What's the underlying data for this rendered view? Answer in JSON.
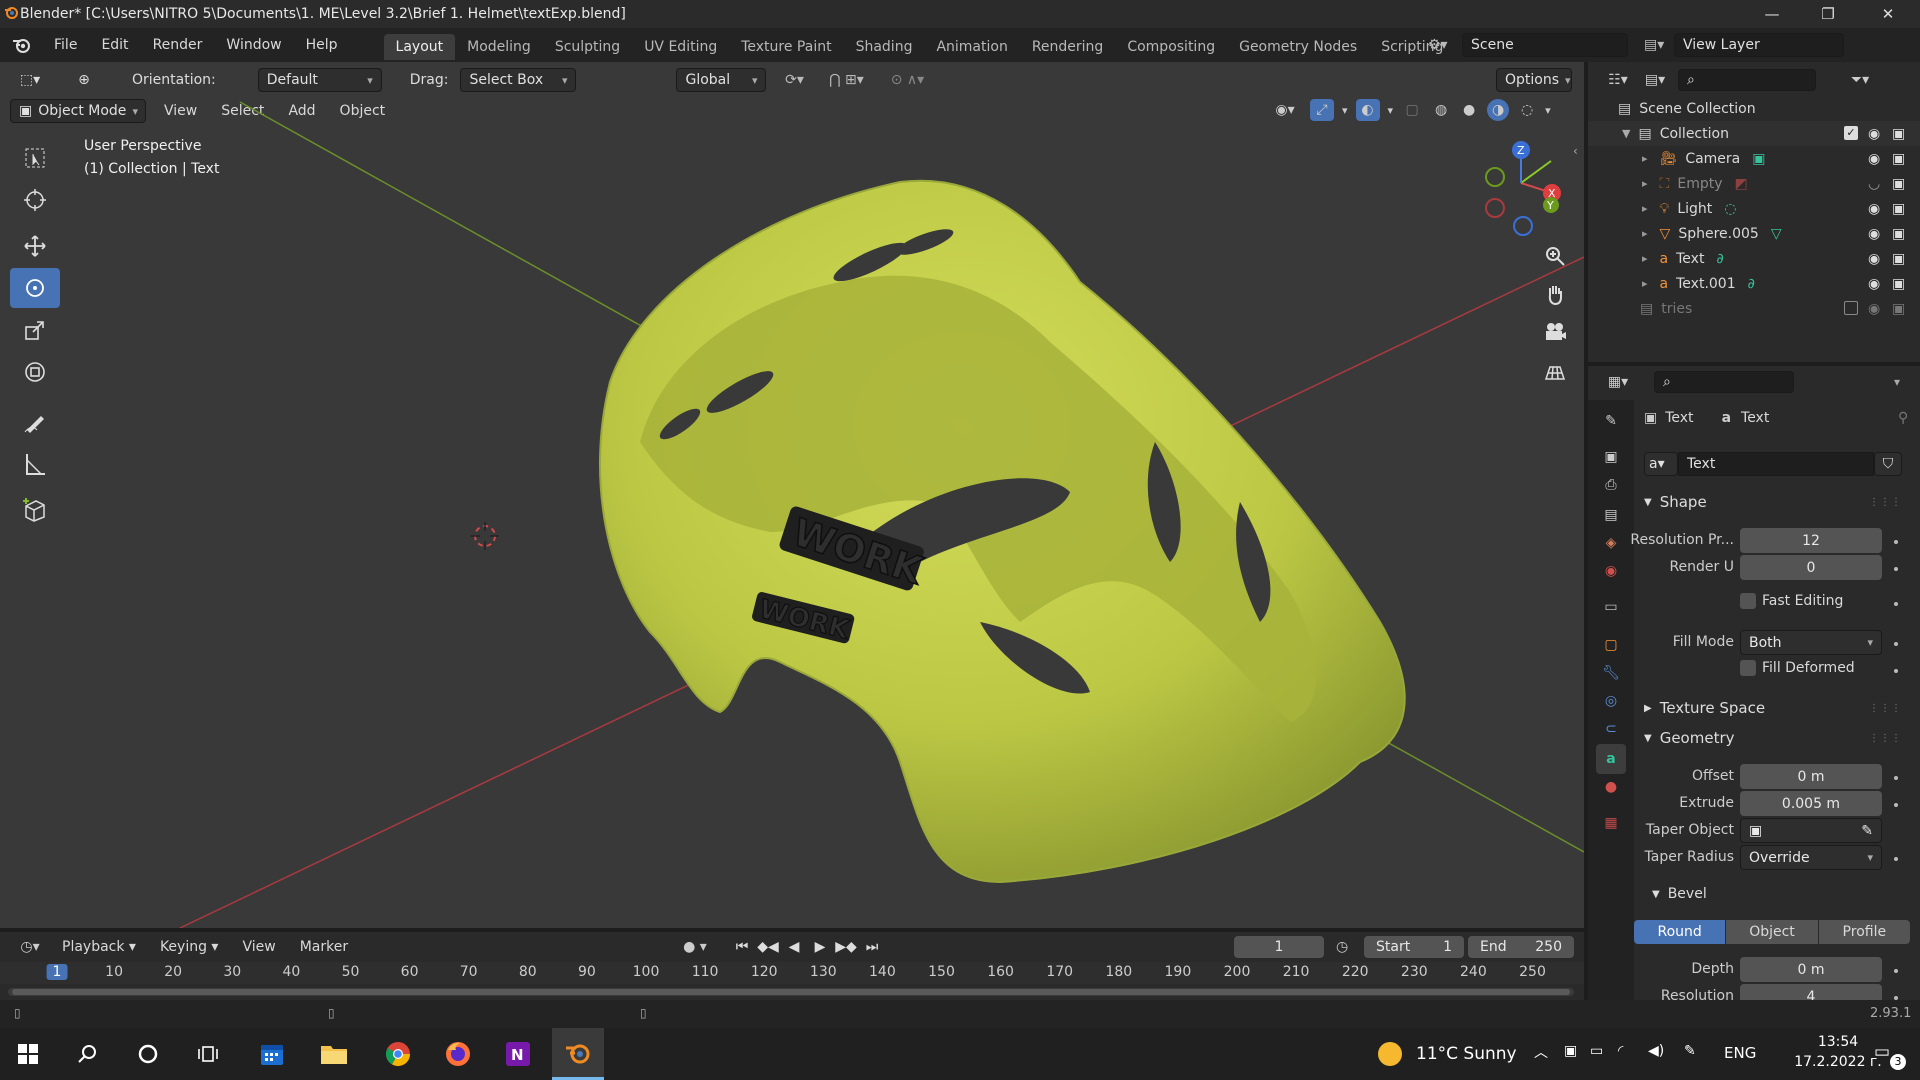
{
  "window": {
    "title": "Blender* [C:\\Users\\NITRO 5\\Documents\\1. ME\\Level 3.2\\Brief 1. Helmet\\textExp.blend]",
    "controls": [
      "—",
      "❐",
      "✕"
    ]
  },
  "menu": {
    "items": [
      "File",
      "Edit",
      "Render",
      "Window",
      "Help"
    ],
    "workspaces": [
      "Layout",
      "Modeling",
      "Sculpting",
      "UV Editing",
      "Texture Paint",
      "Shading",
      "Animation",
      "Rendering",
      "Compositing",
      "Geometry Nodes",
      "Scripting"
    ],
    "active_workspace": "Layout",
    "scene": "Scene",
    "view_layer": "View Layer"
  },
  "viewport": {
    "orientation_label": "Orientation:",
    "orientation_value": "Default",
    "drag_label": "Drag:",
    "drag_value": "Select Box",
    "transform_space": "Global",
    "options_label": "Options",
    "mode": "Object Mode",
    "header_menus": [
      "View",
      "Select",
      "Add",
      "Object"
    ],
    "overlay_title": "User Perspective",
    "overlay_subtitle": "(1) Collection | Text",
    "helmet_color": "#c5d148",
    "gizmo": {
      "x": "X",
      "y": "Y",
      "z": "Z"
    }
  },
  "outliner": {
    "root": "Scene Collection",
    "collection": "Collection",
    "items": [
      {
        "name": "Camera",
        "icon": "camera-icon",
        "dim": false
      },
      {
        "name": "Empty",
        "icon": "empty-icon",
        "dim": true
      },
      {
        "name": "Light",
        "icon": "light-icon",
        "dim": false
      },
      {
        "name": "Sphere.005",
        "icon": "mesh-icon",
        "dim": false
      },
      {
        "name": "Text",
        "icon": "text-icon",
        "dim": false
      },
      {
        "name": "Text.001",
        "icon": "text-icon",
        "dim": false
      }
    ],
    "excluded": "tries"
  },
  "properties": {
    "breadcrumb_object": "Text",
    "breadcrumb_data": "Text",
    "datablock": "Text",
    "shape_header": "Shape",
    "resolution_preview_label": "Resolution Pr...",
    "resolution_preview": "12",
    "render_u_label": "Render U",
    "render_u": "0",
    "fast_editing": "Fast Editing",
    "fill_mode_label": "Fill Mode",
    "fill_mode": "Both",
    "fill_deformed": "Fill Deformed",
    "texture_space_header": "Texture Space",
    "geometry_header": "Geometry",
    "offset_label": "Offset",
    "offset": "0 m",
    "extrude_label": "Extrude",
    "extrude": "0.005 m",
    "taper_object_label": "Taper Object",
    "taper_radius_label": "Taper Radius",
    "taper_radius": "Override",
    "bevel_header": "Bevel",
    "bevel_modes": [
      "Round",
      "Object",
      "Profile"
    ],
    "depth_label": "Depth",
    "depth": "0 m",
    "resolution_label": "Resolution",
    "resolution": "4"
  },
  "timeline": {
    "menus": [
      "Playback",
      "Keying",
      "View",
      "Marker"
    ],
    "current_frame": "1",
    "start_label": "Start",
    "start": "1",
    "end_label": "End",
    "end": "250",
    "ruler": [
      "1",
      "10",
      "20",
      "30",
      "40",
      "50",
      "60",
      "70",
      "80",
      "90",
      "100",
      "110",
      "120",
      "130",
      "140",
      "150",
      "160",
      "170",
      "180",
      "190",
      "200",
      "210",
      "220",
      "230",
      "240",
      "250"
    ]
  },
  "status": {
    "version": "2.93.1"
  },
  "taskbar": {
    "weather": "11°C  Sunny",
    "lang": "ENG",
    "time": "13:54",
    "date": "17.2.2022 г.",
    "notifications": "3"
  }
}
